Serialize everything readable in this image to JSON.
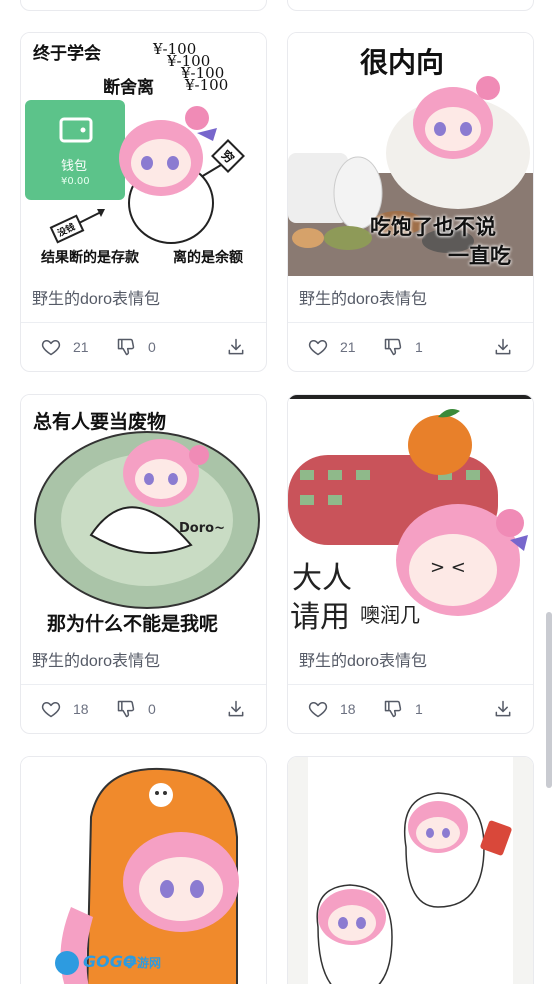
{
  "cards": [
    {
      "title": "野生的doro表情包",
      "likes": "21",
      "dislikes": "0",
      "caption_lines": [
        "终于学会",
        "断舍离",
        "¥-100",
        "¥-100",
        "¥-100",
        "¥-100",
        "钱包",
        "¥0.00",
        "没钱",
        "穷",
        "结果断的是存款",
        "离的是余额"
      ]
    },
    {
      "title": "野生的doro表情包",
      "likes": "21",
      "dislikes": "1",
      "caption_lines": [
        "很内向",
        "吃饱了也不说",
        "一直吃"
      ]
    },
    {
      "title": "野生的doro表情包",
      "likes": "18",
      "dislikes": "0",
      "caption_lines": [
        "总有人要当废物",
        "Doro~",
        "那为什么不能是我呢"
      ]
    },
    {
      "title": "野生的doro表情包",
      "likes": "18",
      "dislikes": "1",
      "caption_lines": [
        "大人",
        "请用",
        "噢润几"
      ]
    },
    {
      "title": "",
      "likes": "",
      "dislikes": "",
      "caption_lines": [
        "GOGO",
        "手游网"
      ]
    },
    {
      "title": "",
      "likes": "",
      "dislikes": "",
      "caption_lines": []
    }
  ],
  "colors": {
    "card_border": "#e9eaee",
    "title_text": "#555a66",
    "count_text": "#6b7080",
    "doro_pink": "#f5a0c4",
    "wallet_green": "#5cc38a"
  },
  "icons": [
    "heart-icon",
    "thumbs-down-icon",
    "download-icon"
  ]
}
